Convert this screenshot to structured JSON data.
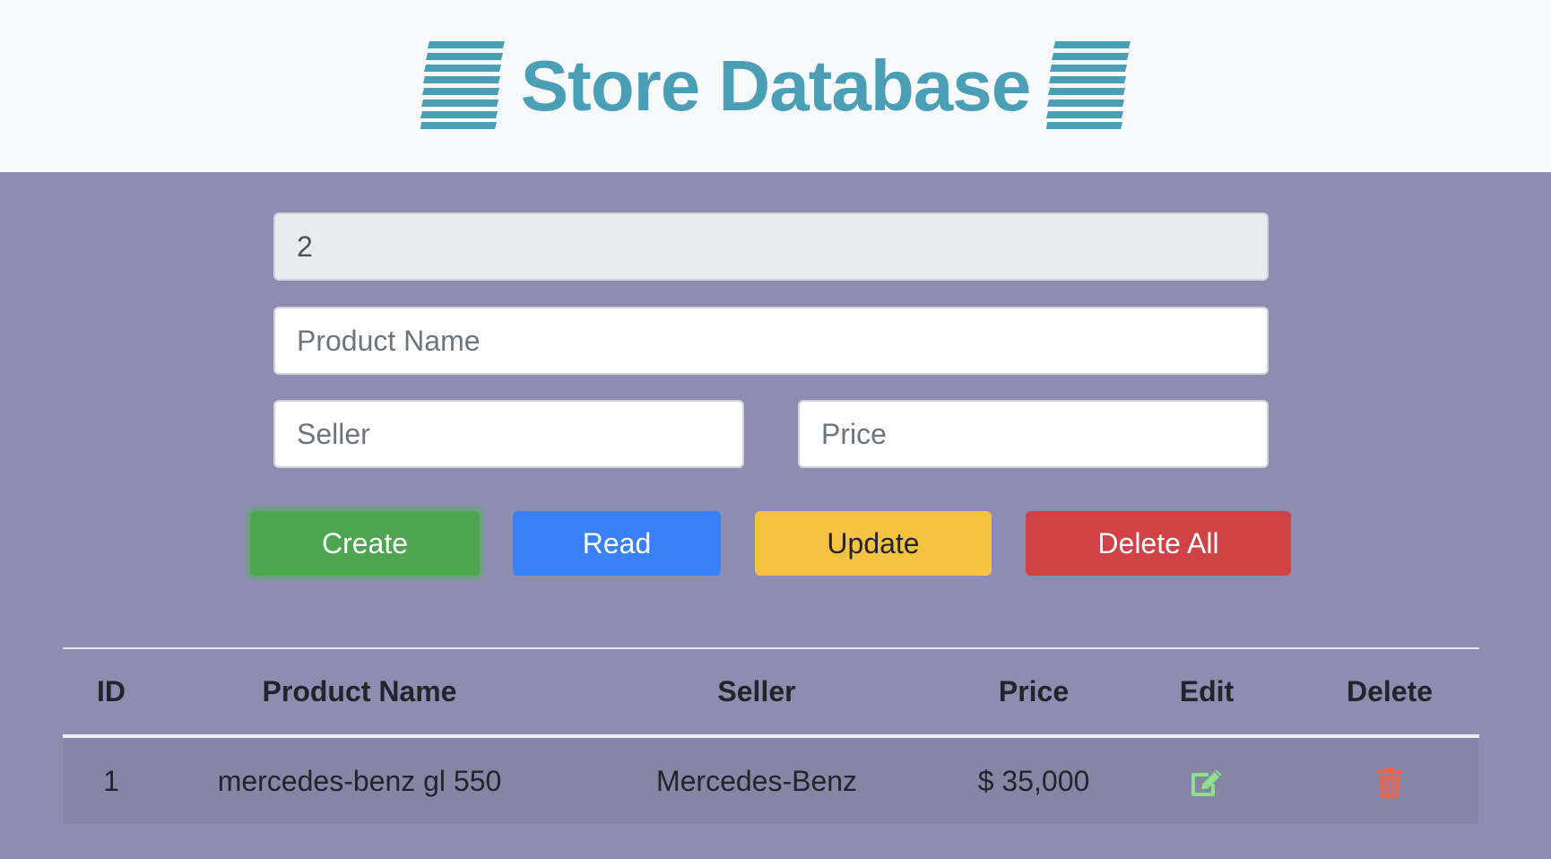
{
  "header": {
    "title": "Store Database",
    "icon_left": "database-icon",
    "icon_right": "database-icon",
    "accent_color": "#4a9fb6"
  },
  "form": {
    "id_value": "2",
    "product_name_placeholder": "Product Name",
    "seller_placeholder": "Seller",
    "price_placeholder": "Price"
  },
  "buttons": {
    "create": "Create",
    "read": "Read",
    "update": "Update",
    "delete_all": "Delete All"
  },
  "table": {
    "headers": [
      "ID",
      "Product Name",
      "Seller",
      "Price",
      "Edit",
      "Delete"
    ],
    "rows": [
      {
        "id": "1",
        "product_name": "mercedes-benz gl 550",
        "seller": "Mercedes-Benz",
        "price": "$ 35,000",
        "edit_icon": "edit-icon",
        "delete_icon": "trash-icon"
      }
    ]
  },
  "colors": {
    "background": "#8c8db0",
    "create": "#4da54f",
    "read": "#3a80f6",
    "update": "#f5c242",
    "delete": "#cf4347",
    "edit_icon": "#8fe08a",
    "trash_icon": "#e8664f"
  }
}
